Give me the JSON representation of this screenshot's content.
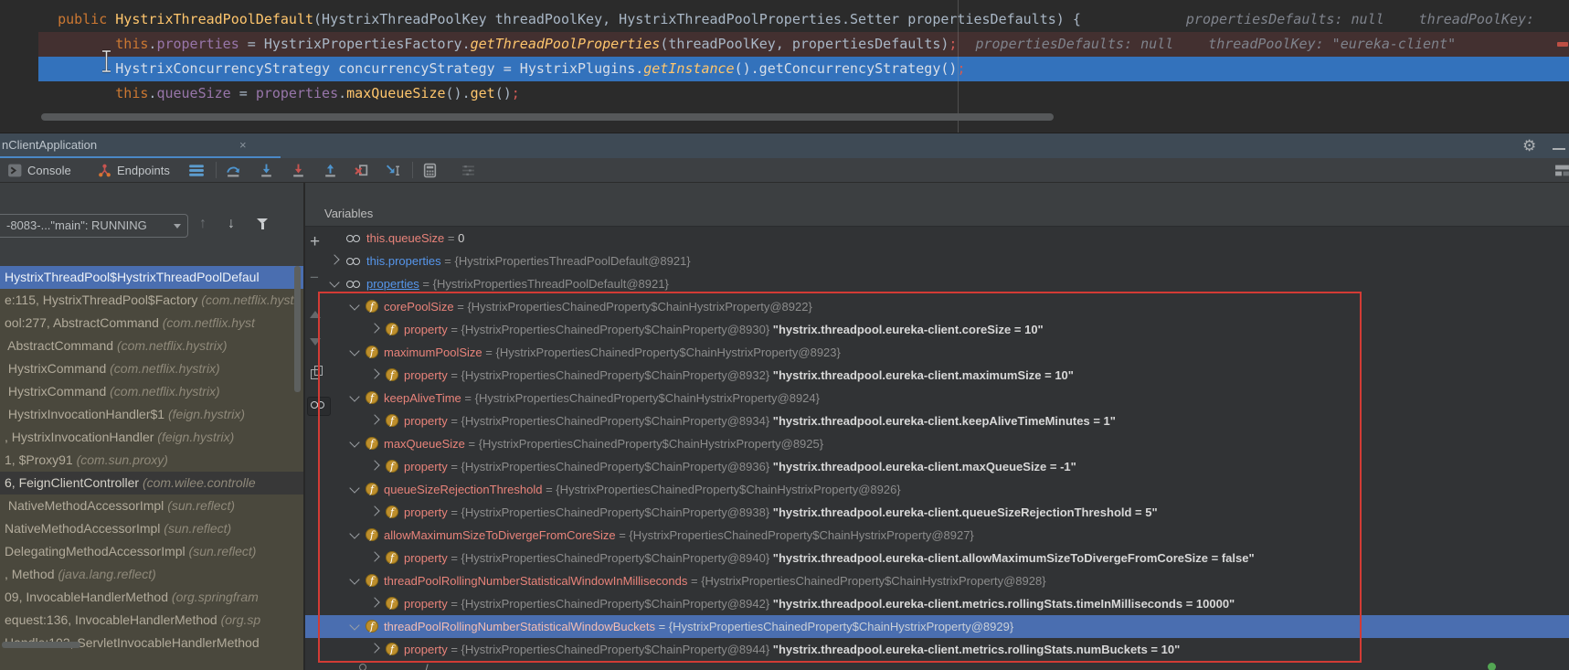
{
  "editor": {
    "lines": [
      {
        "bg": "",
        "tokens": [
          {
            "t": "  ",
            "c": "pln"
          },
          {
            "t": "public ",
            "c": "kw"
          },
          {
            "t": "HystrixThreadPoolDefault",
            "c": "mtd"
          },
          {
            "t": "(HystrixThreadPoolKey threadPoolKey, HystrixThreadPoolProperties.Setter propertiesDefaults) {",
            "c": "pln"
          }
        ],
        "hints": [
          "propertiesDefaults: null",
          "threadPoolKey:"
        ]
      },
      {
        "bg": "bp",
        "tokens": [
          {
            "t": "         ",
            "c": "pln"
          },
          {
            "t": "this",
            "c": "kw"
          },
          {
            "t": ".",
            "c": "pln"
          },
          {
            "t": "properties",
            "c": "fld"
          },
          {
            "t": " = HystrixPropertiesFactory.",
            "c": "pln"
          },
          {
            "t": "getThreadPoolProperties",
            "c": "smtd"
          },
          {
            "t": "(threadPoolKey, propertiesDefaults)",
            "c": "pln"
          },
          {
            "t": ";",
            "c": "semi"
          }
        ],
        "hints": [
          "propertiesDefaults: null",
          "threadPoolKey: \"eureka-client\""
        ]
      },
      {
        "bg": "exec",
        "tokens": [
          {
            "t": "         ",
            "c": "pln"
          },
          {
            "t": "HystrixConcurrencyStrategy concurrencyStrategy = HystrixPlugins.",
            "c": "pln"
          },
          {
            "t": "getInstance",
            "c": "smtd"
          },
          {
            "t": "().getConcurrencyStrategy()",
            "c": "pln"
          },
          {
            "t": ";",
            "c": "semi"
          }
        ],
        "hints": []
      },
      {
        "bg": "",
        "tokens": [
          {
            "t": "         ",
            "c": "pln"
          },
          {
            "t": "this",
            "c": "kw"
          },
          {
            "t": ".",
            "c": "pln"
          },
          {
            "t": "queueSize",
            "c": "fld"
          },
          {
            "t": " = ",
            "c": "pln"
          },
          {
            "t": "properties",
            "c": "fld"
          },
          {
            "t": ".",
            "c": "pln"
          },
          {
            "t": "maxQueueSize",
            "c": "mtd"
          },
          {
            "t": "().",
            "c": "pln"
          },
          {
            "t": "get",
            "c": "mtd"
          },
          {
            "t": "()",
            "c": "pln"
          },
          {
            "t": ";",
            "c": "semi"
          }
        ],
        "hints": []
      }
    ]
  },
  "debug_header": {
    "tab_label": "nClientApplication",
    "close_label": "×"
  },
  "toolbar": {
    "console_label": "Console",
    "endpoints_label": "Endpoints"
  },
  "frames": {
    "thread_selector": "-8083-...\"main\": RUNNING",
    "rows": [
      {
        "main": "HystrixThreadPool$HystrixThreadPoolDefaul",
        "pkg": "",
        "sel": true
      },
      {
        "main": "e:115, HystrixThreadPool$Factory ",
        "pkg": "(com.netflix.hystr"
      },
      {
        "main": "ool:277, AbstractCommand ",
        "pkg": "(com.netflix.hyst"
      },
      {
        "main": " AbstractCommand ",
        "pkg": "(com.netflix.hystrix)"
      },
      {
        "main": " HystrixCommand ",
        "pkg": "(com.netflix.hystrix)"
      },
      {
        "main": " HystrixCommand ",
        "pkg": "(com.netflix.hystrix)"
      },
      {
        "main": " HystrixInvocationHandler$1 ",
        "pkg": "(feign.hystrix)"
      },
      {
        "main": ", HystrixInvocationHandler ",
        "pkg": "(feign.hystrix)"
      },
      {
        "main": "1, $Proxy91 ",
        "pkg": "(com.sun.proxy)"
      },
      {
        "main": "6, FeignClientController ",
        "pkg": "(com.wilee.controlle",
        "dark": true
      },
      {
        "main": " NativeMethodAccessorImpl ",
        "pkg": "(sun.reflect)"
      },
      {
        "main": "NativeMethodAccessorImpl ",
        "pkg": "(sun.reflect)"
      },
      {
        "main": "DelegatingMethodAccessorImpl ",
        "pkg": "(sun.reflect)"
      },
      {
        "main": ", Method ",
        "pkg": "(java.lang.reflect)"
      },
      {
        "main": "09, InvocableHandlerMethod ",
        "pkg": "(org.springfram"
      },
      {
        "main": "equest:136, InvocableHandlerMethod ",
        "pkg": "(org.sp"
      },
      {
        "main": "Handle:102, ServletInvocableHandlerMethod",
        "pkg": ""
      }
    ]
  },
  "variables": {
    "header": "Variables",
    "rows": [
      {
        "ind": 0,
        "exp": "none",
        "icon": "watch",
        "name": "this.queueSize",
        "nc": "pink",
        "ref": "",
        "val": "0",
        "vc": "num"
      },
      {
        "ind": 0,
        "exp": "closed",
        "icon": "watch",
        "name": "this.properties",
        "nc": "blue",
        "ref": "{HystrixPropertiesThreadPoolDefault@8921}"
      },
      {
        "ind": 0,
        "exp": "open",
        "icon": "watch",
        "name": "properties",
        "nc": "blueu",
        "ref": "{HystrixPropertiesThreadPoolDefault@8921}"
      },
      {
        "ind": 1,
        "exp": "open",
        "icon": "field",
        "name": "corePoolSize",
        "nc": "pink",
        "ref": "{HystrixPropertiesChainedProperty$ChainHystrixProperty@8922}"
      },
      {
        "ind": 2,
        "exp": "closed",
        "icon": "field",
        "name": "property",
        "nc": "pink",
        "ref": "{HystrixPropertiesChainedProperty$ChainProperty@8930}",
        "val": "\"hystrix.threadpool.eureka-client.coreSize = 10\""
      },
      {
        "ind": 1,
        "exp": "open",
        "icon": "field",
        "name": "maximumPoolSize",
        "nc": "pink",
        "ref": "{HystrixPropertiesChainedProperty$ChainHystrixProperty@8923}"
      },
      {
        "ind": 2,
        "exp": "closed",
        "icon": "field",
        "name": "property",
        "nc": "pink",
        "ref": "{HystrixPropertiesChainedProperty$ChainProperty@8932}",
        "val": "\"hystrix.threadpool.eureka-client.maximumSize = 10\""
      },
      {
        "ind": 1,
        "exp": "open",
        "icon": "field",
        "name": "keepAliveTime",
        "nc": "pink",
        "ref": "{HystrixPropertiesChainedProperty$ChainHystrixProperty@8924}"
      },
      {
        "ind": 2,
        "exp": "closed",
        "icon": "field",
        "name": "property",
        "nc": "pink",
        "ref": "{HystrixPropertiesChainedProperty$ChainProperty@8934}",
        "val": "\"hystrix.threadpool.eureka-client.keepAliveTimeMinutes = 1\""
      },
      {
        "ind": 1,
        "exp": "open",
        "icon": "field",
        "name": "maxQueueSize",
        "nc": "pink",
        "ref": "{HystrixPropertiesChainedProperty$ChainHystrixProperty@8925}"
      },
      {
        "ind": 2,
        "exp": "closed",
        "icon": "field",
        "name": "property",
        "nc": "pink",
        "ref": "{HystrixPropertiesChainedProperty$ChainProperty@8936}",
        "val": "\"hystrix.threadpool.eureka-client.maxQueueSize = -1\""
      },
      {
        "ind": 1,
        "exp": "open",
        "icon": "field",
        "name": "queueSizeRejectionThreshold",
        "nc": "pink",
        "ref": "{HystrixPropertiesChainedProperty$ChainHystrixProperty@8926}"
      },
      {
        "ind": 2,
        "exp": "closed",
        "icon": "field",
        "name": "property",
        "nc": "pink",
        "ref": "{HystrixPropertiesChainedProperty$ChainProperty@8938}",
        "val": "\"hystrix.threadpool.eureka-client.queueSizeRejectionThreshold = 5\""
      },
      {
        "ind": 1,
        "exp": "open",
        "icon": "field",
        "name": "allowMaximumSizeToDivergeFromCoreSize",
        "nc": "pink",
        "ref": "{HystrixPropertiesChainedProperty$ChainHystrixProperty@8927}"
      },
      {
        "ind": 2,
        "exp": "closed",
        "icon": "field",
        "name": "property",
        "nc": "pink",
        "ref": "{HystrixPropertiesChainedProperty$ChainProperty@8940}",
        "val": "\"hystrix.threadpool.eureka-client.allowMaximumSizeToDivergeFromCoreSize = false\""
      },
      {
        "ind": 1,
        "exp": "open",
        "icon": "field",
        "name": "threadPoolRollingNumberStatisticalWindowInMilliseconds",
        "nc": "pink",
        "ref": "{HystrixPropertiesChainedProperty$ChainHystrixProperty@8928}"
      },
      {
        "ind": 2,
        "exp": "closed",
        "icon": "field",
        "name": "property",
        "nc": "pink",
        "ref": "{HystrixPropertiesChainedProperty$ChainProperty@8942}",
        "val": "\"hystrix.threadpool.eureka-client.metrics.rollingStats.timeInMilliseconds = 10000\""
      },
      {
        "ind": 1,
        "exp": "open",
        "icon": "field",
        "name": "threadPoolRollingNumberStatisticalWindowBuckets",
        "nc": "pink",
        "ref": "{HystrixPropertiesChainedProperty$ChainHystrixProperty@8929}",
        "sel": true
      },
      {
        "ind": 2,
        "exp": "closed",
        "icon": "field",
        "name": "property",
        "nc": "pink",
        "ref": "{HystrixPropertiesChainedProperty$ChainProperty@8944}",
        "val": "\"hystrix.threadpool.eureka-client.metrics.rollingStats.numBuckets = 10\""
      }
    ]
  },
  "icon_names": [
    "console-icon",
    "endpoints-icon",
    "menu-icon",
    "step-over-icon",
    "step-into-icon",
    "force-step-into-icon",
    "step-out-icon",
    "drop-frame-icon",
    "run-to-cursor-icon",
    "evaluate-expression-icon",
    "view-options-icon",
    "layout-icon",
    "gear-icon",
    "minimize-icon",
    "close-icon",
    "filter-icon",
    "up-arrow-icon",
    "down-arrow-icon",
    "add-watch-icon",
    "remove-watch-icon",
    "move-up-icon",
    "move-down-icon",
    "copy-icon",
    "show-watches-icon",
    "watch-icon",
    "field-icon",
    "chevron-down-icon",
    "chevron-right-icon",
    "text-cursor"
  ],
  "colors": {
    "accent_underline": "#4A88C7",
    "annotation_box": "#D23B35",
    "execution_line": "#3372BC",
    "breakpoint_line": "#433030",
    "selection_blue": "#4A6EB0",
    "frames_bg": "#4A483D",
    "field_icon": "#BD8E2C"
  }
}
